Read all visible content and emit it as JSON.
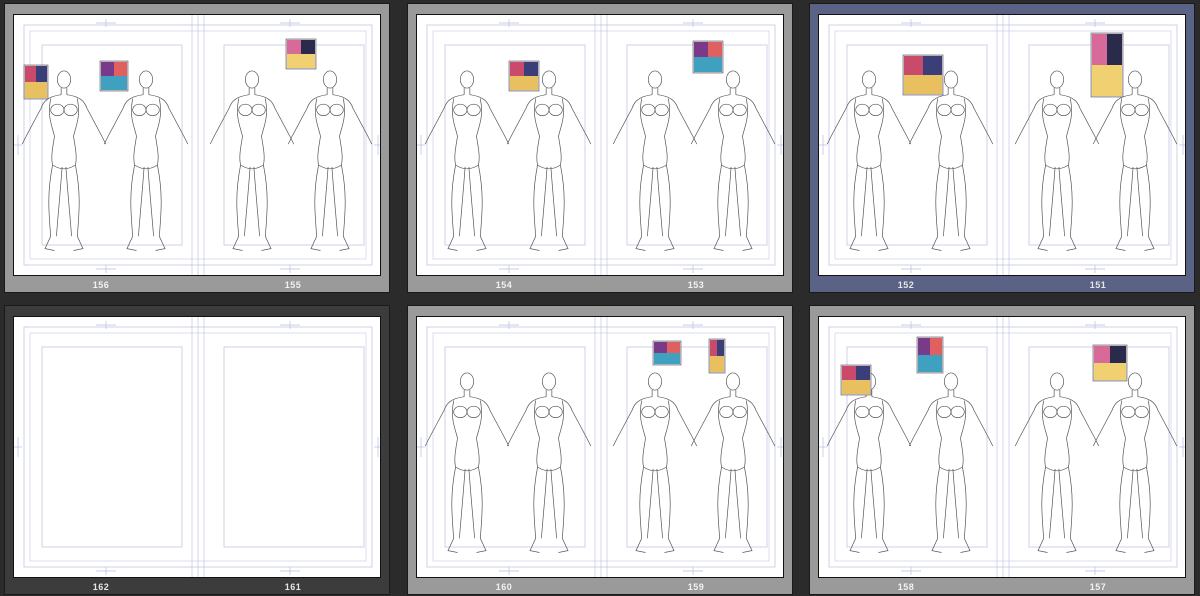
{
  "spreads": [
    {
      "left_page": "156",
      "right_page": "155",
      "state": "normal",
      "content": "sketch"
    },
    {
      "left_page": "154",
      "right_page": "153",
      "state": "normal",
      "content": "sketch"
    },
    {
      "left_page": "152",
      "right_page": "151",
      "state": "selected",
      "content": "sketch"
    },
    {
      "left_page": "162",
      "right_page": "161",
      "state": "dark",
      "content": "blank"
    },
    {
      "left_page": "160",
      "right_page": "159",
      "state": "normal",
      "content": "sketch"
    },
    {
      "left_page": "158",
      "right_page": "157",
      "state": "normal",
      "content": "sketch"
    }
  ],
  "colors": {
    "app_background": "#2b2b2b",
    "spread_frame_normal": "#9a9a9a",
    "spread_frame_selected": "#5a6286",
    "spread_frame_dark": "#3c3c3c",
    "guide_lines": "#b8bde0",
    "sketch_lines": "#555555"
  },
  "icons": [
    "figure-sketch-icon",
    "reference-image-icon",
    "register-mark-icon"
  ]
}
